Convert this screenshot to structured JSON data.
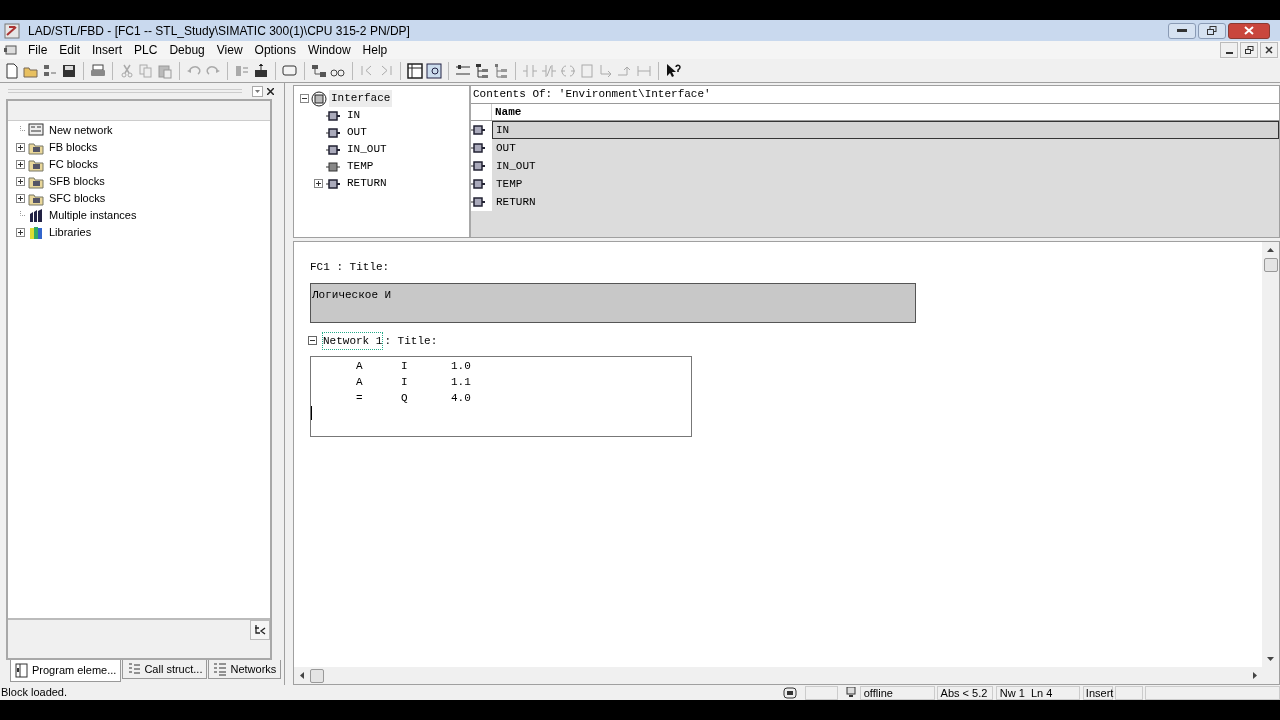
{
  "window": {
    "title": "LAD/STL/FBD  - [FC1 -- STL_Study\\SIMATIC 300(1)\\CPU 315-2 PN/DP]"
  },
  "menu": [
    "File",
    "Edit",
    "Insert",
    "PLC",
    "Debug",
    "View",
    "Options",
    "Window",
    "Help"
  ],
  "catalog": {
    "items": [
      {
        "label": "New network",
        "kind": "network"
      },
      {
        "label": "FB blocks",
        "kind": "folder"
      },
      {
        "label": "FC blocks",
        "kind": "folder"
      },
      {
        "label": "SFB blocks",
        "kind": "folder"
      },
      {
        "label": "SFC blocks",
        "kind": "folder"
      },
      {
        "label": "Multiple instances",
        "kind": "instances"
      },
      {
        "label": "Libraries",
        "kind": "library"
      }
    ],
    "tabs": [
      {
        "label": "Program eleme...",
        "selected": true
      },
      {
        "label": "Call struct...",
        "selected": false
      },
      {
        "label": "Networks",
        "selected": false
      }
    ]
  },
  "interface_tree": {
    "label": "Interface",
    "expanded": true,
    "selected": true,
    "children": [
      {
        "label": "IN",
        "kind": "param",
        "selected": false
      },
      {
        "label": "OUT",
        "kind": "param",
        "selected": false
      },
      {
        "label": "IN_OUT",
        "kind": "param",
        "selected": false
      },
      {
        "label": "TEMP",
        "kind": "temp",
        "selected": false
      },
      {
        "label": "RETURN",
        "kind": "group",
        "selected": false
      }
    ]
  },
  "contents": {
    "heading": "Contents Of: 'Environment\\Interface'",
    "column": "Name",
    "rows": [
      {
        "name": "IN",
        "selected": true
      },
      {
        "name": "OUT",
        "selected": false
      },
      {
        "name": "IN_OUT",
        "selected": false
      },
      {
        "name": "TEMP",
        "selected": false
      },
      {
        "name": "RETURN",
        "selected": false
      }
    ]
  },
  "editor": {
    "block_title": "FC1 : Title:",
    "block_comment": "Логическое И",
    "networks": [
      {
        "name": "Network 1",
        "title": ": Title:",
        "expanded": true,
        "lines": [
          {
            "op": "A",
            "operand": "I",
            "address": "1.0"
          },
          {
            "op": "A",
            "operand": "I",
            "address": "1.1"
          },
          {
            "op": "=",
            "operand": "Q",
            "address": "4.0"
          }
        ]
      }
    ]
  },
  "status_bar": {
    "message": "Block loaded.",
    "mode": "offline",
    "abs": "Abs < 5.2",
    "position": "Nw 1  Ln 4",
    "insert": "Insert"
  }
}
